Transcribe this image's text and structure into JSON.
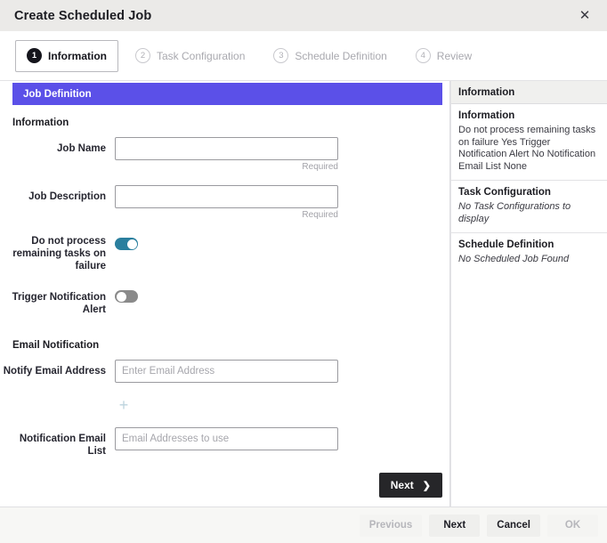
{
  "window": {
    "title": "Create Scheduled Job",
    "close_icon": "close-icon"
  },
  "steps": [
    {
      "number": "1",
      "label": "Information",
      "active": true
    },
    {
      "number": "2",
      "label": "Task Configuration",
      "active": false
    },
    {
      "number": "3",
      "label": "Schedule Definition",
      "active": false
    },
    {
      "number": "4",
      "label": "Review",
      "active": false
    }
  ],
  "section_bar": {
    "label": "Job Definition",
    "color": "#5b50e8"
  },
  "form": {
    "group_information": "Information",
    "job_name": {
      "label": "Job Name",
      "value": "",
      "placeholder": "",
      "note": "Required"
    },
    "job_description": {
      "label": "Job Description",
      "value": "",
      "placeholder": "",
      "note": "Required"
    },
    "do_not_process": {
      "label": "Do not process remaining tasks on failure",
      "state": "on"
    },
    "trigger_notification": {
      "label": "Trigger Notification Alert",
      "state": "off"
    },
    "group_email": "Email Notification",
    "notify_email": {
      "label": "Notify Email Address",
      "value": "",
      "placeholder": "Enter Email Address"
    },
    "add_email_icon": "plus-icon",
    "notification_list": {
      "label": "Notification Email List",
      "value": "",
      "placeholder": "Email Addresses to use"
    },
    "next_inline": {
      "label": "Next",
      "chevron": "❯"
    }
  },
  "side": {
    "header": "Information",
    "sections": [
      {
        "title": "Information",
        "lines": "Do not process remaining tasks on failure Yes Trigger Notification Alert No Notification Email List None",
        "empty": ""
      },
      {
        "title": "Task Configuration",
        "lines": "",
        "empty": "No Task Configurations to display"
      },
      {
        "title": "Schedule Definition",
        "lines": "",
        "empty": "No Scheduled Job Found"
      }
    ]
  },
  "footer": {
    "previous": "Previous",
    "next": "Next",
    "cancel": "Cancel",
    "ok": "OK"
  }
}
